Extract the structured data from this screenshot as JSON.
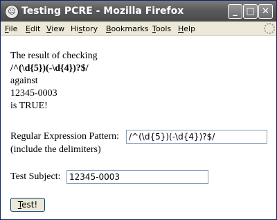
{
  "window": {
    "title": "Testing PCRE - Mozilla Firefox",
    "controls": {
      "minimize": "_",
      "maximize": "□",
      "close": "✕"
    }
  },
  "menu": {
    "items": [
      {
        "label_hot": "F",
        "label_rest": "ile"
      },
      {
        "label_hot": "E",
        "label_rest": "dit"
      },
      {
        "label_hot": "V",
        "label_rest": "iew"
      },
      {
        "label_pre": "Hi",
        "label_hot": "s",
        "label_rest": "tory"
      },
      {
        "label_hot": "B",
        "label_rest": "ookmarks"
      },
      {
        "label_hot": "T",
        "label_rest": "ools"
      },
      {
        "label_hot": "H",
        "label_rest": "elp"
      }
    ]
  },
  "result": {
    "line1": "The result of checking",
    "pattern": "/^(\\d{5})(-\\d{4})?$/",
    "line3": "against",
    "subject": "12345-0003",
    "line5": "is TRUE!"
  },
  "form": {
    "pattern_label": "Regular Expression Pattern:",
    "pattern_value": "/^(\\d{5})(-\\d{4})?$/",
    "pattern_hint": "(include the delimiters)",
    "subject_label": "Test Subject:",
    "subject_value": "12345-0003",
    "submit_hot": "T",
    "submit_rest": "est!"
  }
}
